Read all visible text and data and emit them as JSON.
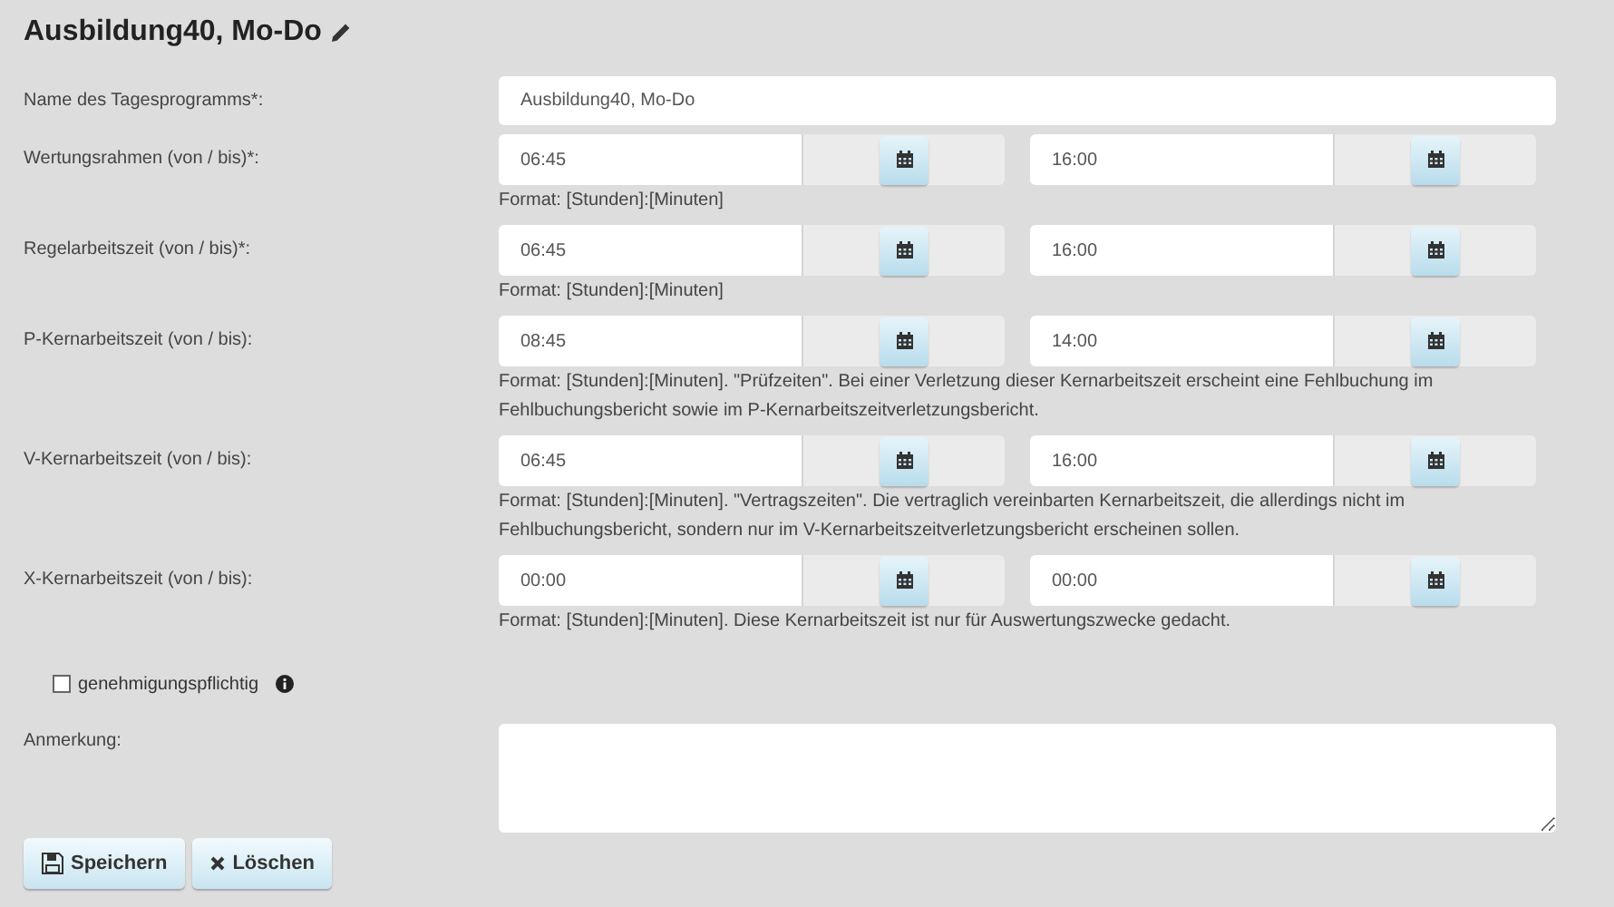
{
  "title": "Ausbildung40, Mo-Do",
  "rows": [
    {
      "kind": "text",
      "label": "Name des Tagesprogramms*:",
      "value": "Ausbildung40, Mo-Do"
    },
    {
      "kind": "time",
      "label": "Wertungsrahmen (von / bis)*:",
      "from": "06:45",
      "to": "16:00",
      "hint": "Format: [Stunden]:[Minuten]"
    },
    {
      "kind": "time",
      "label": "Regelarbeitszeit (von / bis)*:",
      "from": "06:45",
      "to": "16:00",
      "hint": "Format: [Stunden]:[Minuten]"
    },
    {
      "kind": "time",
      "label": "P-Kernarbeitszeit (von / bis):",
      "from": "08:45",
      "to": "14:00",
      "hint": "Format: [Stunden]:[Minuten]. \"Prüfzeiten\". Bei einer Verletzung dieser Kernarbeitszeit erscheint eine Fehlbuchung im Fehlbuchungsbericht sowie im P-Kernarbeitszeitverletzungsbericht."
    },
    {
      "kind": "time",
      "label": "V-Kernarbeitszeit (von / bis):",
      "from": "06:45",
      "to": "16:00",
      "hint": "Format: [Stunden]:[Minuten]. \"Vertragszeiten\". Die vertraglich vereinbarten Kernarbeitszeit, die allerdings nicht im Fehlbuchungsbericht, sondern nur im V-Kernarbeitszeitverletzungsbericht erscheinen sollen."
    },
    {
      "kind": "time",
      "label": "X-Kernarbeitszeit (von / bis):",
      "from": "00:00",
      "to": "00:00",
      "hint": "Format: [Stunden]:[Minuten]. Diese Kernarbeitszeit ist nur für Auswertungszwecke gedacht."
    }
  ],
  "approval": {
    "label": "genehmigungspflichtig",
    "checked": false
  },
  "remark": {
    "label": "Anmerkung:"
  },
  "buttons": [
    {
      "kind": "save",
      "label": "Speichern"
    },
    {
      "kind": "delete",
      "label": "Löschen"
    }
  ]
}
